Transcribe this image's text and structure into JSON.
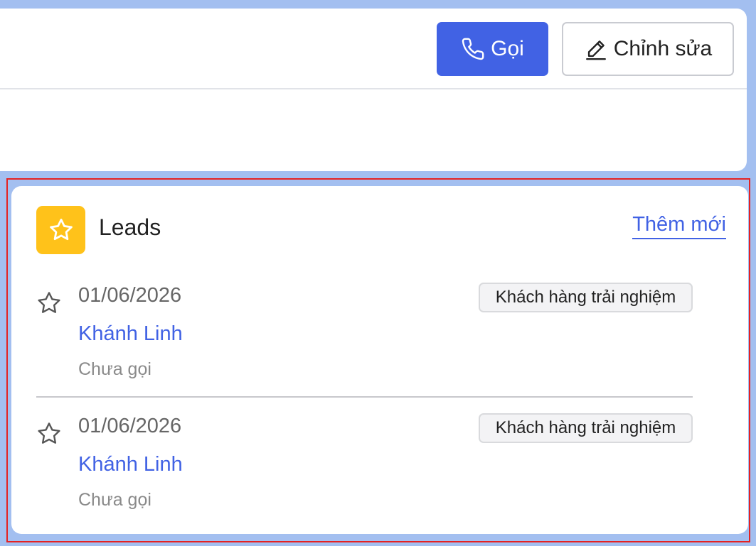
{
  "toolbar": {
    "call_label": "Gọi",
    "edit_label": "Chỉnh sửa"
  },
  "leads": {
    "title": "Leads",
    "add_label": "Thêm mới",
    "items": [
      {
        "date": "01/06/2026",
        "name": "Khánh Linh",
        "status": "Chưa gọi",
        "tag": "Khách hàng trải nghiệm"
      },
      {
        "date": "01/06/2026",
        "name": "Khánh Linh",
        "status": "Chưa gọi",
        "tag": "Khách hàng trải nghiệm"
      }
    ]
  },
  "icons": {
    "call": "phone-icon",
    "edit": "pencil-icon",
    "leads": "star-icon",
    "item": "star-outline-icon"
  },
  "colors": {
    "primary": "#4162e4",
    "leads_icon_bg": "#ffc21a",
    "background": "#a3bff0",
    "highlight": "#e52222"
  }
}
